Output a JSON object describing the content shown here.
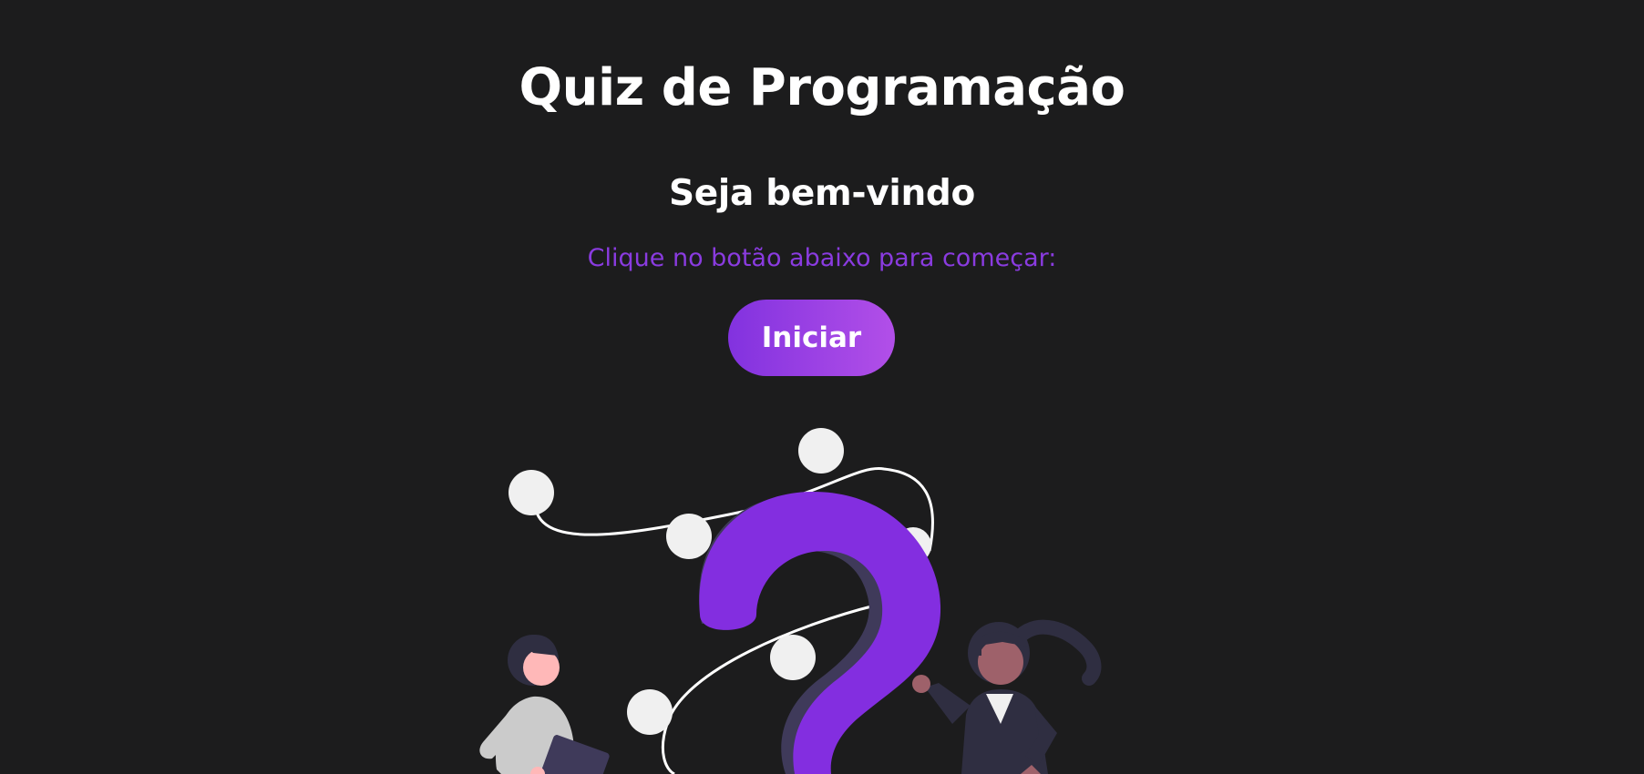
{
  "main": {
    "title": "Quiz de Programação",
    "welcome": "Seja bem-vindo",
    "instruction": "Clique no botão abaixo para começar:",
    "start_button_label": "Iniciar"
  },
  "illustration": {
    "icon": "question-mark-people-illustration"
  },
  "colors": {
    "background": "#1c1c1d",
    "accent_purple": "#8232df",
    "accent_gradient_end": "#b24fe8",
    "text_primary": "#ffffff",
    "instruction_text": "#8a3be0"
  }
}
